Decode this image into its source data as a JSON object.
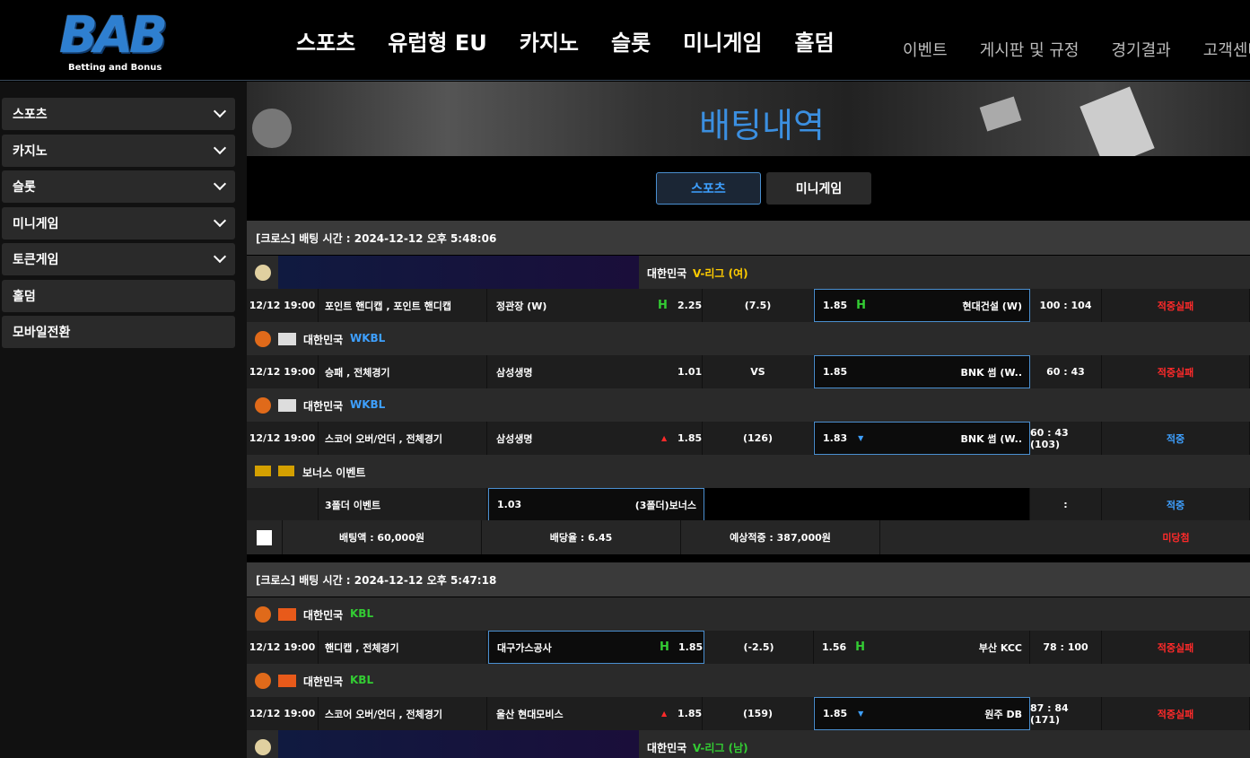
{
  "logo": {
    "big": "BAB",
    "small": "Betting and Bonus"
  },
  "main_nav": [
    "스포츠",
    "유럽형 EU",
    "카지노",
    "슬롯",
    "미니게임",
    "홀덤"
  ],
  "sub_nav": [
    "이벤트",
    "게시판 및 규정",
    "경기결과",
    "고객센터"
  ],
  "sidebar": {
    "items": [
      {
        "label": "스포츠"
      },
      {
        "label": "카지노"
      },
      {
        "label": "슬롯"
      },
      {
        "label": "미니게임"
      },
      {
        "label": "토큰게임"
      },
      {
        "label": "홀덤"
      },
      {
        "label": "모바일전환"
      }
    ]
  },
  "page_title": "배팅내역",
  "tabs": {
    "sports": "스포츠",
    "minigame": "미니게임"
  },
  "bet1": {
    "header": "[크로스] 배팅 시간 : 2024-12-12 오후 5:48:06",
    "leagues": [
      {
        "country": "대한민국",
        "league": "V-리그 (여)",
        "color": "#ffcc00"
      },
      {
        "country": "대한민국",
        "league": "WKBL",
        "color": "#3ea0ff"
      },
      {
        "country": "대한민국",
        "league": "WKBL",
        "color": "#3ea0ff"
      },
      {
        "country": "보너스 이벤트",
        "league": "",
        "color": "#fff"
      }
    ],
    "games": [
      {
        "time": "12/12 19:00",
        "market": "포인트 핸디캡 , 포인트 핸디캡",
        "home": "정관장 (W)",
        "home_odd": "2.25",
        "line": "(7.5)",
        "away_odd": "1.85",
        "away": "현대건설 (W)",
        "score": "100 : 104",
        "result": "적중실패"
      },
      {
        "time": "12/12 19:00",
        "market": "승패 , 전체경기",
        "home": "삼성생명",
        "home_odd": "1.01",
        "line": "VS",
        "away_odd": "1.85",
        "away": "BNK 썸 (W..",
        "score": "60 : 43",
        "result": "적중실패"
      },
      {
        "time": "12/12 19:00",
        "market": "스코어 오버/언더 , 전체경기",
        "home": "삼성생명",
        "home_odd": "1.85",
        "line": "(126)",
        "away_odd": "1.83",
        "away": "BNK 썸 (W..",
        "score": "60 : 43 (103)",
        "result": "적중"
      },
      {
        "time": "",
        "market": "3폴더 이벤트",
        "home": "1.03",
        "home_odd": "(3폴더)보너스",
        "line": "",
        "away_odd": "",
        "away": "",
        "score": ":",
        "result": "적중"
      }
    ],
    "summary": {
      "amount": "배팅액 : 60,000원",
      "rate": "배당율 : 6.45",
      "expected": "예상적중 : 387,000원",
      "status": "미당첨"
    }
  },
  "bet2": {
    "header": "[크로스] 배팅 시간 : 2024-12-12 오후 5:47:18",
    "leagues": [
      {
        "country": "대한민국",
        "league": "KBL",
        "color": "#33cc33"
      },
      {
        "country": "대한민국",
        "league": "KBL",
        "color": "#33cc33"
      },
      {
        "country": "대한민국",
        "league": "V-리그 (남)",
        "color": "#33cc33"
      }
    ],
    "games": [
      {
        "time": "12/12 19:00",
        "market": "핸디캡 , 전체경기",
        "home": "대구가스공사",
        "home_odd": "1.85",
        "line": "(-2.5)",
        "away_odd": "1.56",
        "away": "부산 KCC",
        "score": "78 : 100",
        "result": "적중실패"
      },
      {
        "time": "12/12 19:00",
        "market": "스코어 오버/언더 , 전체경기",
        "home": "울산 현대모비스",
        "home_odd": "1.85",
        "line": "(159)",
        "away_odd": "1.85",
        "away": "원주 DB",
        "score": "87 : 84 (171)",
        "result": "적중실패"
      }
    ]
  },
  "icons": {
    "chevron": "chevron-down-icon",
    "volleyball": "volleyball-icon",
    "basketball": "basketball-icon",
    "handicap": "h-icon"
  }
}
